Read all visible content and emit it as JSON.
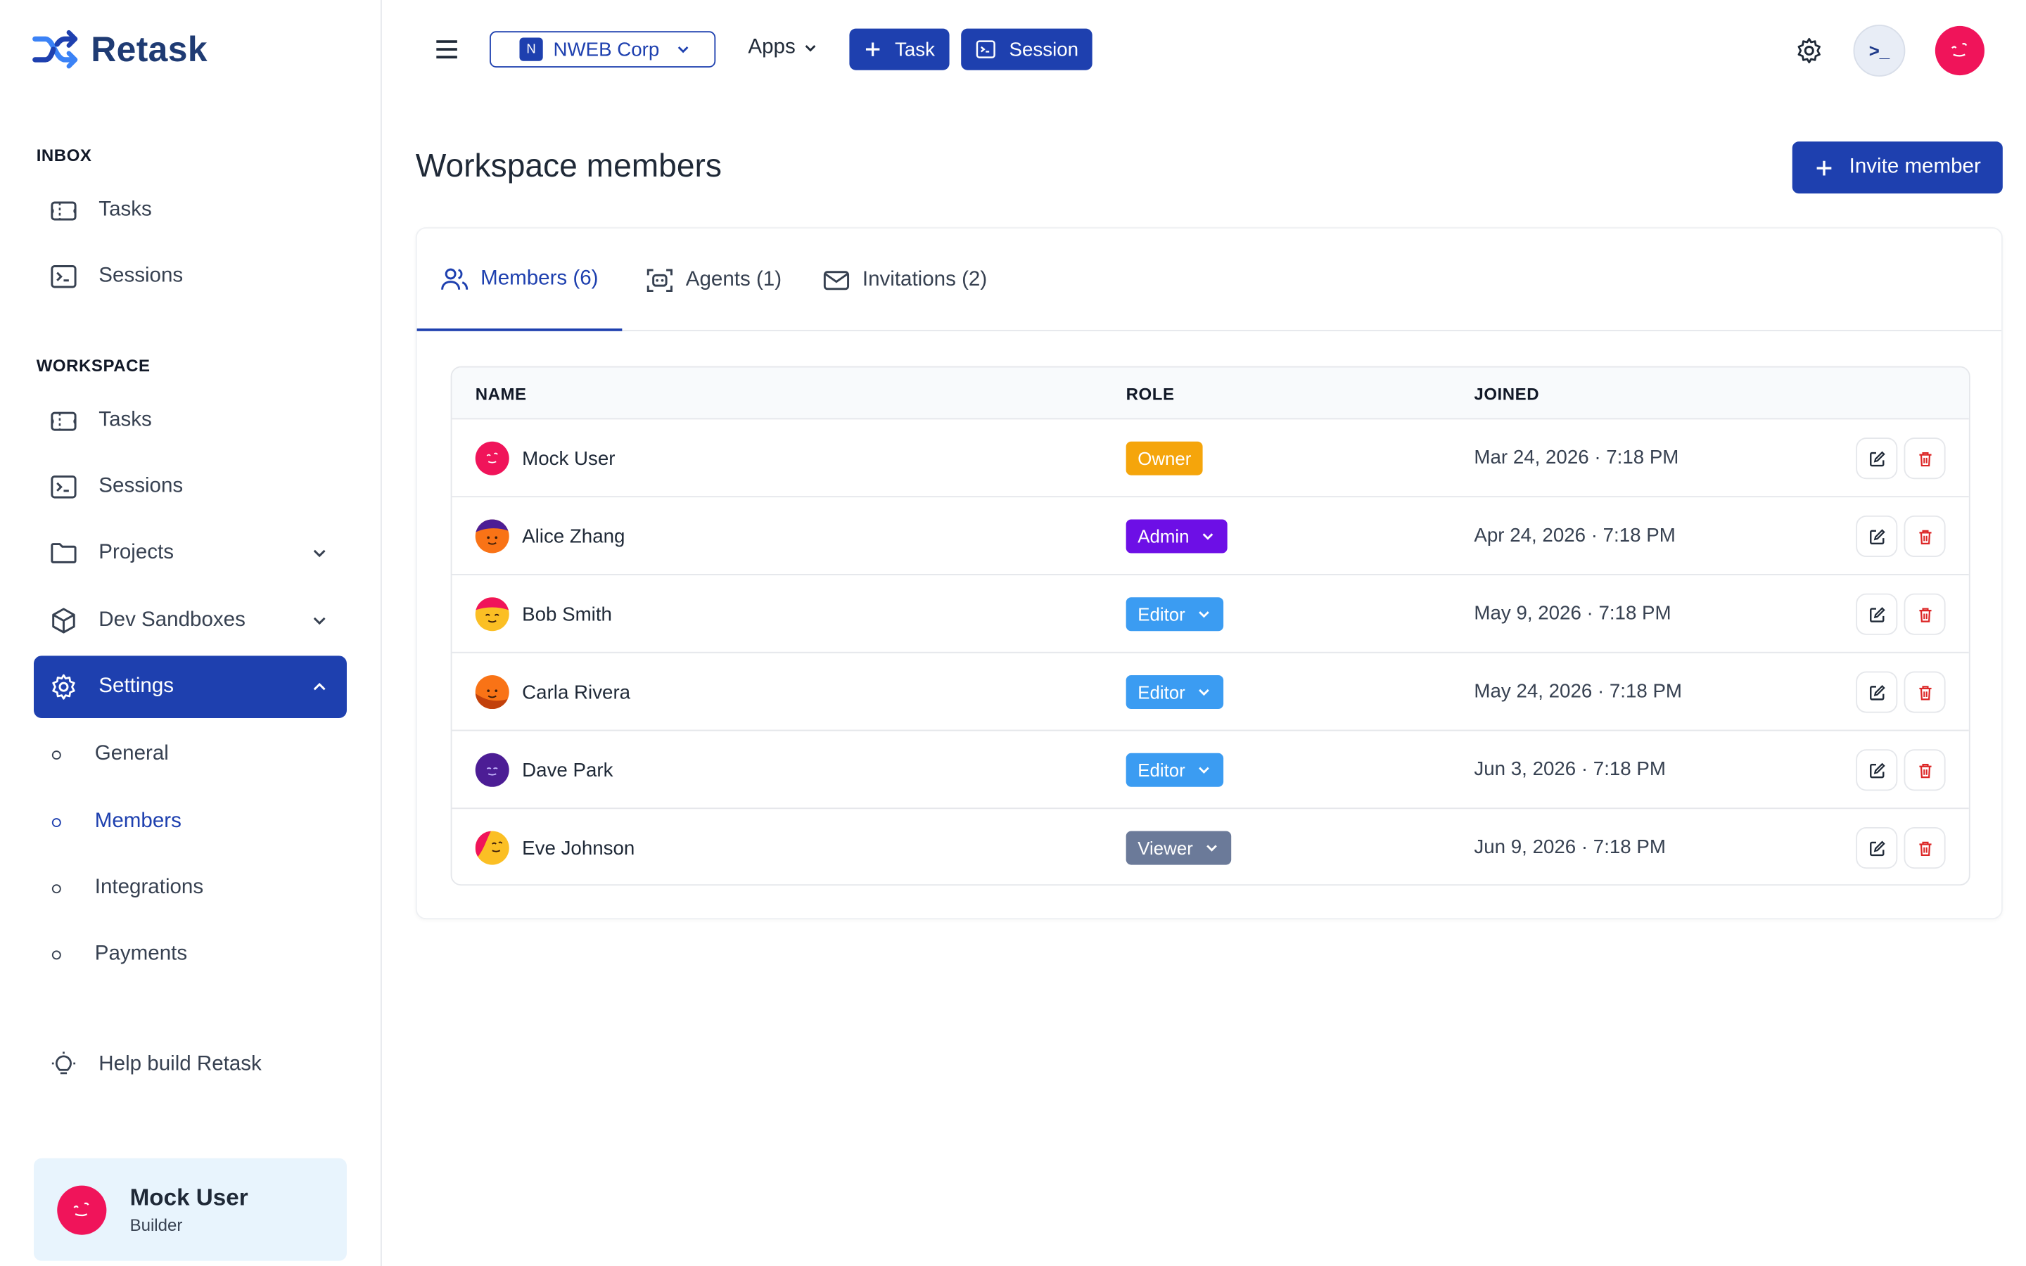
{
  "brand": {
    "name": "Retask"
  },
  "sidebar": {
    "inbox_label": "INBOX",
    "inbox_items": [
      {
        "label": "Tasks",
        "icon": "ticket-icon"
      },
      {
        "label": "Sessions",
        "icon": "terminal-icon"
      }
    ],
    "workspace_label": "WORKSPACE",
    "workspace_items": [
      {
        "label": "Tasks",
        "icon": "ticket-icon"
      },
      {
        "label": "Sessions",
        "icon": "terminal-icon"
      },
      {
        "label": "Projects",
        "icon": "folder-icon"
      },
      {
        "label": "Dev Sandboxes",
        "icon": "cube-icon"
      },
      {
        "label": "Settings",
        "icon": "gear-icon"
      }
    ],
    "settings_sub": [
      {
        "label": "General"
      },
      {
        "label": "Members"
      },
      {
        "label": "Integrations"
      },
      {
        "label": "Payments"
      }
    ],
    "help_label": "Help build Retask",
    "user": {
      "name": "Mock User",
      "role": "Builder"
    }
  },
  "topbar": {
    "workspace_badge": "N",
    "workspace_name": "NWEB Corp",
    "apps_label": "Apps",
    "task_label": "Task",
    "session_label": "Session",
    "terminal_glyph": ">_"
  },
  "main": {
    "title": "Workspace members",
    "invite_label": "Invite member",
    "tabs": [
      {
        "label": "Members (6)"
      },
      {
        "label": "Agents (1)"
      },
      {
        "label": "Invitations (2)"
      }
    ],
    "columns": {
      "name": "NAME",
      "role": "ROLE",
      "joined": "JOINED"
    },
    "members": [
      {
        "name": "Mock User",
        "role": "Owner",
        "joined": "Mar 24, 2026 · 7:18 PM"
      },
      {
        "name": "Alice Zhang",
        "role": "Admin",
        "joined": "Apr 24, 2026 · 7:18 PM"
      },
      {
        "name": "Bob Smith",
        "role": "Editor",
        "joined": "May 9, 2026 · 7:18 PM"
      },
      {
        "name": "Carla Rivera",
        "role": "Editor",
        "joined": "May 24, 2026 · 7:18 PM"
      },
      {
        "name": "Dave Park",
        "role": "Editor",
        "joined": "Jun 3, 2026 · 7:18 PM"
      },
      {
        "name": "Eve Johnson",
        "role": "Viewer",
        "joined": "Jun 9, 2026 · 7:18 PM"
      }
    ]
  },
  "colors": {
    "primary": "#1e40af",
    "owner": "#f5a50b",
    "admin": "#6d0fe6",
    "editor": "#3b9cf2",
    "viewer": "#6b7a99",
    "danger": "#dc2626"
  }
}
